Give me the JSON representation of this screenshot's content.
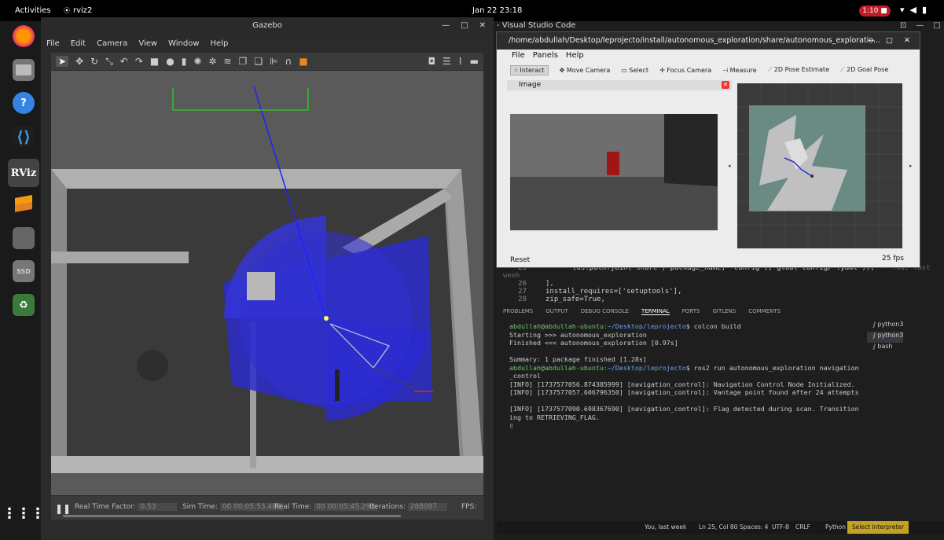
{
  "topbar": {
    "activities": "Activities",
    "app": "rviz2",
    "clock": "Jan 22  23:18",
    "recording": "1:10"
  },
  "dock": [
    "firefox-icon",
    "files-icon",
    "help-icon",
    "vscode-icon",
    "rviz-icon",
    "stack-icon",
    "drive-icon",
    "ssd-icon",
    "trash-icon",
    "apps-grid-icon"
  ],
  "gazebo": {
    "title": "Gazebo",
    "menu": [
      "File",
      "Edit",
      "Camera",
      "View",
      "Window",
      "Help"
    ],
    "bottom": {
      "rtf_label": "Real Time Factor:",
      "rtf": "0.53",
      "simtime_label": "Sim Time:",
      "simtime": "00 00:05:53.489",
      "realtime_label": "Real Time:",
      "realtime": "00 00:05:45.293",
      "iter_label": "Iterations:",
      "iter": "288087",
      "fps_label": "FPS:"
    }
  },
  "vscode": {
    "title": "Visual Studio Code",
    "code": [
      {
        "ln": "25",
        "text": "(os.path.join('share', package_name, 'config'), glob('config/*.yaml')),"
      },
      {
        "ln": "26",
        "text": "],"
      },
      {
        "ln": "27",
        "text": "install_requires=['setuptools'],"
      },
      {
        "ln": "28",
        "text": "zip_safe=True,"
      }
    ],
    "blame": "You, last week",
    "panel_tabs": [
      "PROBLEMS",
      "OUTPUT",
      "DEBUG CONSOLE",
      "TERMINAL",
      "PORTS",
      "GITLENS",
      "COMMENTS"
    ],
    "terminal": {
      "prompt1": "abdullah@abdullah-ubuntu",
      "path1": ":~/Desktop/leprojecto",
      "cmd1": "$ colcon build",
      "l2": "Starting >>> autonomous_exploration",
      "l3": "Finished <<< autonomous_exploration [0.97s]",
      "l4": "Summary: 1 package finished [1.28s]",
      "prompt2": "abdullah@abdullah-ubuntu",
      "path2": ":~/Desktop/leprojecto",
      "cmd2": "$ ros2 run autonomous_exploration navigation",
      "cmd2b": "_control",
      "i1": "[INFO] [1737577056.874385999] [navigation_control]: Navigation Control Node Initialized.",
      "i2": "[INFO] [1737577057.606796350] [navigation_control]: Vantage point found after 24 attempts",
      "i3": "[INFO] [1737577090.698367690] [navigation_control]: Flag detected during scan. Transition",
      "i3b": "ing to RETRIEVING_FLAG."
    },
    "shells": [
      "python3",
      "python3",
      "bash"
    ],
    "status": {
      "blame": "You, last week",
      "pos": "Ln 25, Col 80",
      "spaces": "Spaces: 4",
      "enc": "UTF-8",
      "eol": "CRLF",
      "lang": "Python",
      "interp": "Select Interpreter"
    }
  },
  "rviz": {
    "title": "/home/abdullah/Desktop/leprojecto/install/autonomous_exploration/share/autonomous_exploratio...",
    "menu": [
      "File",
      "Panels",
      "Help"
    ],
    "tools": [
      "Interact",
      "Move Camera",
      "Select",
      "Focus Camera",
      "Measure",
      "2D Pose Estimate",
      "2D Goal Pose"
    ],
    "image_panel": "Image",
    "reset": "Reset",
    "fps": "25 fps"
  }
}
